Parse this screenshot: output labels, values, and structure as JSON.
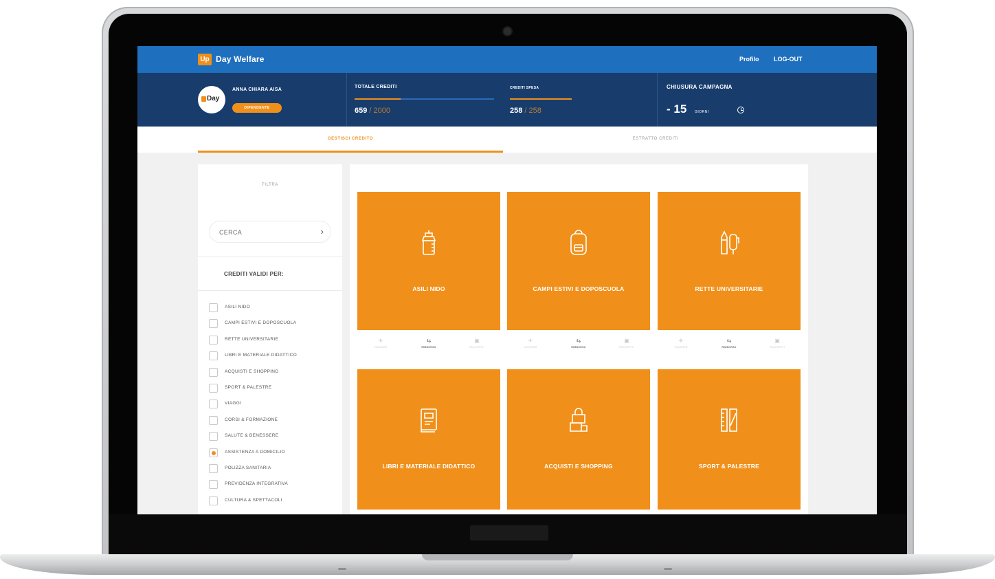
{
  "header": {
    "logo_mark": "Up",
    "brand": "Day Welfare",
    "nav": [
      {
        "label": "Profilo"
      },
      {
        "label": "LOG-OUT"
      }
    ]
  },
  "user": {
    "avatar_text": "Day",
    "name": "ANNA CHIARA AISA",
    "role": "DIPENDENTE"
  },
  "credits": {
    "total": {
      "label": "TOTALE CREDITI",
      "value": "659",
      "max": " / 2000",
      "progress": 0.33
    },
    "spent": {
      "label": "CREDITI SPESA",
      "value": "258",
      "max": " / 258",
      "progress": 1.0
    }
  },
  "campaign": {
    "label": "CHIUSURA CAMPAGNA",
    "value": "- 15",
    "unit": "GIORNI",
    "icon": "clock-icon"
  },
  "tabs": [
    {
      "label": "GESTISCI CREDITO",
      "active": true
    },
    {
      "label": "ESTRATTO CREDITI",
      "active": false
    }
  ],
  "sidebar": {
    "filter_title": "FILTRA",
    "search_placeholder": "CERCA",
    "search_arrow": "›",
    "valid_for": "CREDITI VALIDI PER:",
    "categories": [
      {
        "label": "ASILI NIDO",
        "checked": false
      },
      {
        "label": "CAMPI ESTIVI E DOPOSCUOLA",
        "checked": false
      },
      {
        "label": "RETTE UNIVERSITARIE",
        "checked": false
      },
      {
        "label": "LIBRI E MATERIALE DIDATTICO",
        "checked": false
      },
      {
        "label": "ACQUISTI E SHOPPING",
        "checked": false
      },
      {
        "label": "SPORT & PALESTRE",
        "checked": false
      },
      {
        "label": "VIAGGI",
        "checked": false
      },
      {
        "label": "CORSI & FORMAZIONE",
        "checked": false
      },
      {
        "label": "SALUTE & BENESSERE",
        "checked": false
      },
      {
        "label": "ASSISTENZA A DOMICILIO",
        "checked": true
      },
      {
        "label": "POLIZZA SANITARIA",
        "checked": false
      },
      {
        "label": "PREVIDENZA INTEGRATIVA",
        "checked": false
      },
      {
        "label": "CULTURA & SPETTACOLI",
        "checked": false
      }
    ]
  },
  "services": [
    {
      "title": "ASILI NIDO",
      "icon": "baby-bottle-icon"
    },
    {
      "title": "CAMPI ESTIVI E DOPOSCUOLA",
      "icon": "backpack-icon"
    },
    {
      "title": "RETTE UNIVERSITARIE",
      "icon": "pencils-icon"
    },
    {
      "title": "LIBRI E MATERIALE DIDATTICO",
      "icon": "book-icon"
    },
    {
      "title": "ACQUISTI E SHOPPING",
      "icon": "shopping-bag-icon"
    },
    {
      "title": "SPORT & PALESTRE",
      "icon": "ruler-icon"
    }
  ],
  "service_options": [
    {
      "label": "VOUCHER",
      "icon": "voucher-icon"
    },
    {
      "label": "RIMBORSO",
      "icon": "refund-icon"
    },
    {
      "label": "PACCHETTI",
      "icon": "package-icon"
    }
  ],
  "colors": {
    "header_blue": "#1e6fbd",
    "navy": "#183d6d",
    "orange": "#f0901a"
  }
}
